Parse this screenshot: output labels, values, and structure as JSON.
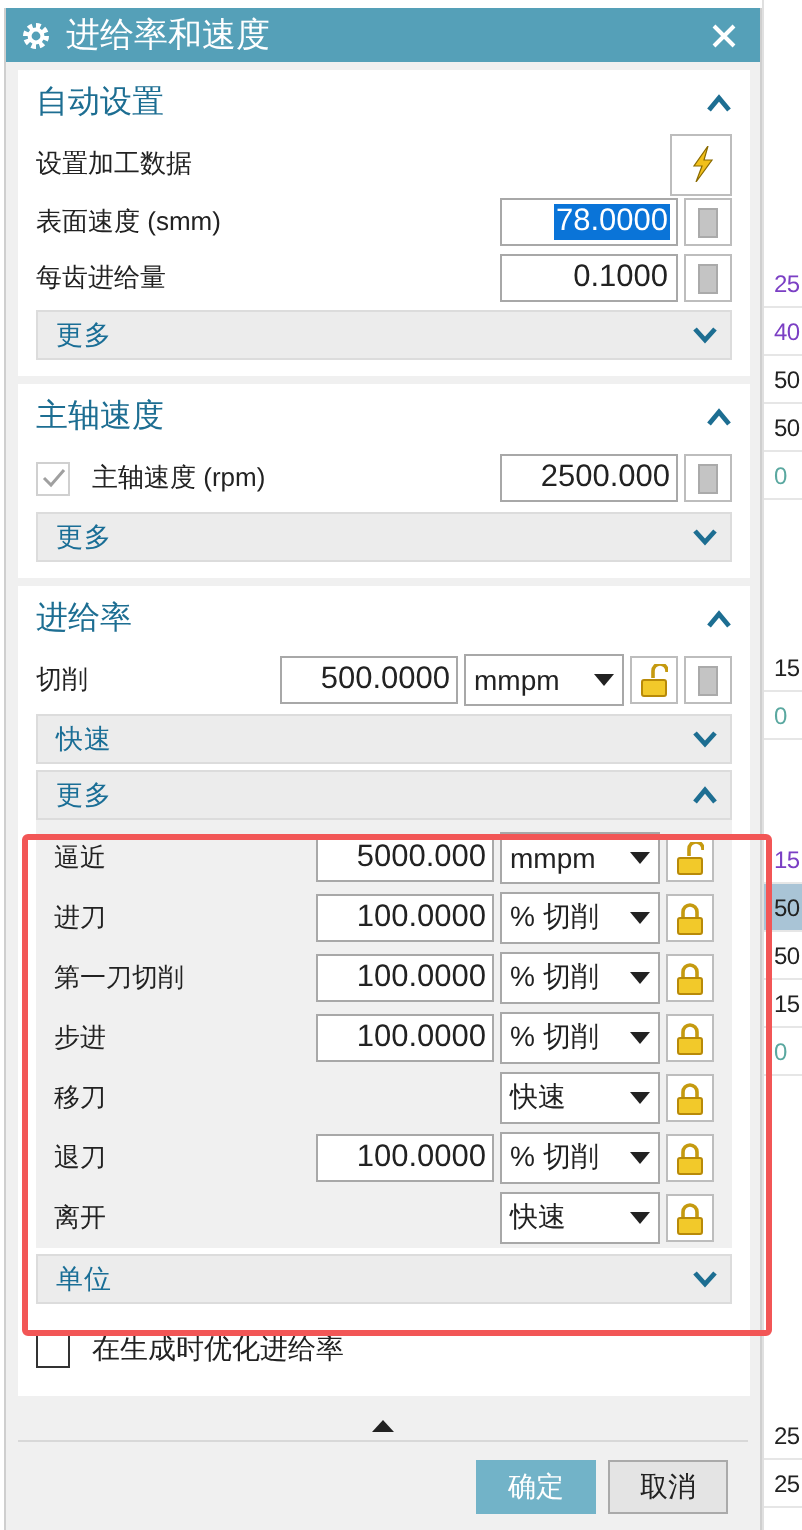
{
  "window": {
    "title": "进给率和速度"
  },
  "sections": [
    {
      "title": "自动设置",
      "expanded": true,
      "rows": [
        {
          "kind": "action",
          "label": "设置加工数据"
        },
        {
          "kind": "number",
          "label": "表面速度 (smm)",
          "value": "78.0000",
          "selected": true
        },
        {
          "kind": "number",
          "label": "每齿进给量",
          "value": "0.1000",
          "selected": false
        }
      ],
      "bars": [
        {
          "title": "更多",
          "expanded": false
        }
      ]
    },
    {
      "title": "主轴速度",
      "expanded": true,
      "rows": [
        {
          "kind": "toggle-number",
          "label": "主轴速度 (rpm)",
          "value": "2500.000",
          "checked": true,
          "disabled": true
        }
      ],
      "bars": [
        {
          "title": "更多",
          "expanded": false
        }
      ]
    },
    {
      "title": "进给率",
      "expanded": true,
      "rows": [
        {
          "kind": "rate",
          "label": "切削",
          "value": "500.0000",
          "unit": "mmpm",
          "locked": false
        }
      ],
      "bars": [
        {
          "title": "快速",
          "expanded": false
        },
        {
          "title": "更多",
          "expanded": true,
          "rows": [
            {
              "kind": "rate",
              "label": "逼近",
              "value": "5000.000",
              "unit": "mmpm",
              "locked": false
            },
            {
              "kind": "rate",
              "label": "进刀",
              "value": "100.0000",
              "unit": "% 切削",
              "locked": true
            },
            {
              "kind": "rate",
              "label": "第一刀切削",
              "value": "100.0000",
              "unit": "% 切削",
              "locked": true
            },
            {
              "kind": "rate",
              "label": "步进",
              "value": "100.0000",
              "unit": "% 切削",
              "locked": true
            },
            {
              "kind": "rate",
              "label": "移刀",
              "unit": "快速",
              "locked": true
            },
            {
              "kind": "rate",
              "label": "退刀",
              "value": "100.0000",
              "unit": "% 切削",
              "locked": true
            },
            {
              "kind": "rate",
              "label": "离开",
              "unit": "快速",
              "locked": true
            }
          ]
        },
        {
          "title": "单位",
          "expanded": false
        }
      ],
      "options": [
        {
          "label": "在生成时优化进给率",
          "checked": false
        }
      ]
    }
  ],
  "buttons": [
    {
      "label": "确定",
      "kind": "primary"
    },
    {
      "label": "取消",
      "kind": "secondary"
    }
  ],
  "annotation": {
    "kind": "highlight-frame"
  },
  "background_sheet": {
    "blocks": [
      {
        "cells": [
          {
            "text": "25",
            "color": "#7b3fc4",
            "selected": false
          },
          {
            "text": "40",
            "color": "#7b3fc4",
            "selected": false
          },
          {
            "text": "50",
            "color": "#222222",
            "selected": false
          },
          {
            "text": "50",
            "color": "#222222",
            "selected": false
          },
          {
            "text": "0",
            "color": "#5aa8a0",
            "selected": false
          }
        ]
      },
      {
        "cells": [
          {
            "text": "15",
            "color": "#222222",
            "selected": false
          },
          {
            "text": "0",
            "color": "#5aa8a0",
            "selected": false
          }
        ]
      },
      {
        "cells": [
          {
            "text": "15",
            "color": "#7b3fc4",
            "selected": false
          },
          {
            "text": "50",
            "color": "#222222",
            "selected": true
          },
          {
            "text": "50",
            "color": "#222222",
            "selected": false
          },
          {
            "text": "15",
            "color": "#222222",
            "selected": false
          },
          {
            "text": "0",
            "color": "#5aa8a0",
            "selected": false
          }
        ]
      },
      {
        "cells": [
          {
            "text": "25",
            "color": "#222222",
            "selected": false
          },
          {
            "text": "25",
            "color": "#222222",
            "selected": false
          }
        ]
      }
    ]
  }
}
